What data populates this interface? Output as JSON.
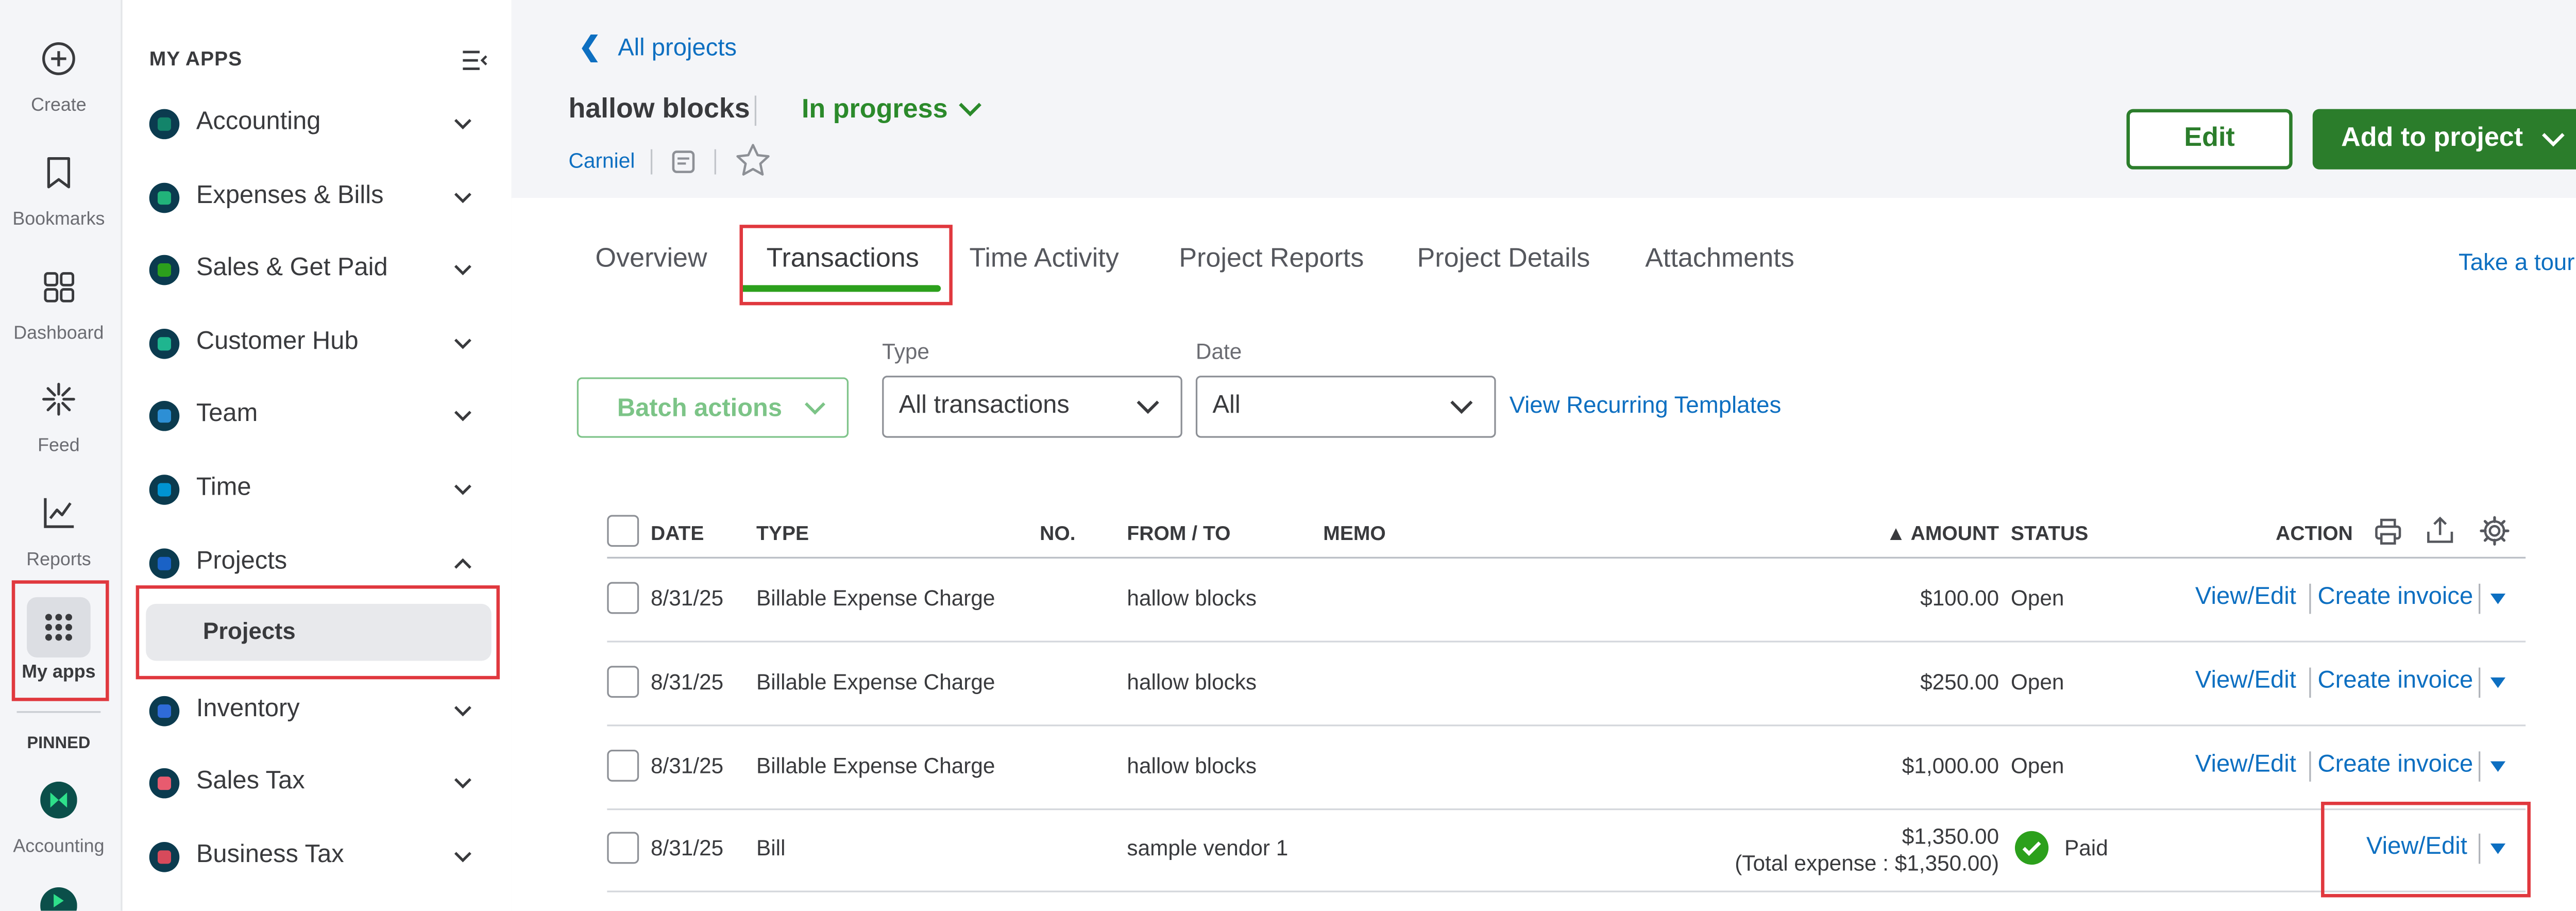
{
  "rail": {
    "items": [
      {
        "label": "Create",
        "icon": "create-icon"
      },
      {
        "label": "Bookmarks",
        "icon": "bookmark-icon"
      },
      {
        "label": "Dashboard",
        "icon": "dashboard-icon"
      },
      {
        "label": "Feed",
        "icon": "feed-icon"
      },
      {
        "label": "Reports",
        "icon": "reports-icon"
      },
      {
        "label": "My apps",
        "icon": "apps-grid-icon"
      }
    ],
    "pinned_label": "PINNED",
    "pinned": [
      {
        "label": "Accounting",
        "icon": "accounting-app-icon"
      }
    ]
  },
  "apps_panel": {
    "title": "MY APPS",
    "items": [
      {
        "label": "Accounting",
        "color": "#13846a"
      },
      {
        "label": "Expenses & Bills",
        "color": "#21b37a"
      },
      {
        "label": "Sales & Get Paid",
        "color": "#2ca01c"
      },
      {
        "label": "Customer Hub",
        "color": "#1fb58f"
      },
      {
        "label": "Team",
        "color": "#2d8fd5"
      },
      {
        "label": "Time",
        "color": "#0094d3"
      },
      {
        "label": "Projects",
        "color": "#1a62c6"
      },
      {
        "label": "Inventory",
        "color": "#2f6bd8"
      },
      {
        "label": "Sales Tax",
        "color": "#e85b6f"
      },
      {
        "label": "Business Tax",
        "color": "#d74a5b"
      }
    ],
    "sub_item": "Projects"
  },
  "header": {
    "back_link": "All projects",
    "project_name": "hallow blocks",
    "status": "In progress",
    "customer": "Carniel",
    "edit_label": "Edit",
    "add_label": "Add to project"
  },
  "tabs": [
    {
      "label": "Overview"
    },
    {
      "label": "Transactions"
    },
    {
      "label": "Time Activity"
    },
    {
      "label": "Project Reports"
    },
    {
      "label": "Project Details"
    },
    {
      "label": "Attachments"
    }
  ],
  "take_tour": "Take a tour",
  "filters": {
    "batch_label": "Batch actions",
    "type_label": "Type",
    "type_value": "All transactions",
    "date_label": "Date",
    "date_value": "All",
    "recurring_link": "View Recurring Templates"
  },
  "table": {
    "headers": {
      "date": "DATE",
      "type": "TYPE",
      "no": "NO.",
      "from_to": "FROM / TO",
      "memo": "MEMO",
      "amount": "▲ AMOUNT",
      "status": "STATUS",
      "action": "ACTION"
    },
    "rows": [
      {
        "date": "8/31/25",
        "type": "Billable Expense Charge",
        "from_to": "hallow blocks",
        "amount": "$100.00",
        "status": "Open",
        "view": "View/Edit",
        "create": "Create invoice"
      },
      {
        "date": "8/31/25",
        "type": "Billable Expense Charge",
        "from_to": "hallow blocks",
        "amount": "$250.00",
        "status": "Open",
        "view": "View/Edit",
        "create": "Create invoice"
      },
      {
        "date": "8/31/25",
        "type": "Billable Expense Charge",
        "from_to": "hallow blocks",
        "amount": "$1,000.00",
        "status": "Open",
        "view": "View/Edit",
        "create": "Create invoice"
      },
      {
        "date": "8/31/25",
        "type": "Bill",
        "from_to": "sample vendor 1",
        "amount": "$1,350.00",
        "amount_note": "(Total expense : $1,350.00)",
        "status": "Paid",
        "view": "View/Edit"
      }
    ]
  },
  "colors": {
    "brand_green": "#2b7d2b",
    "link_blue": "#0d6fc1",
    "highlight_red": "#e0383e"
  }
}
